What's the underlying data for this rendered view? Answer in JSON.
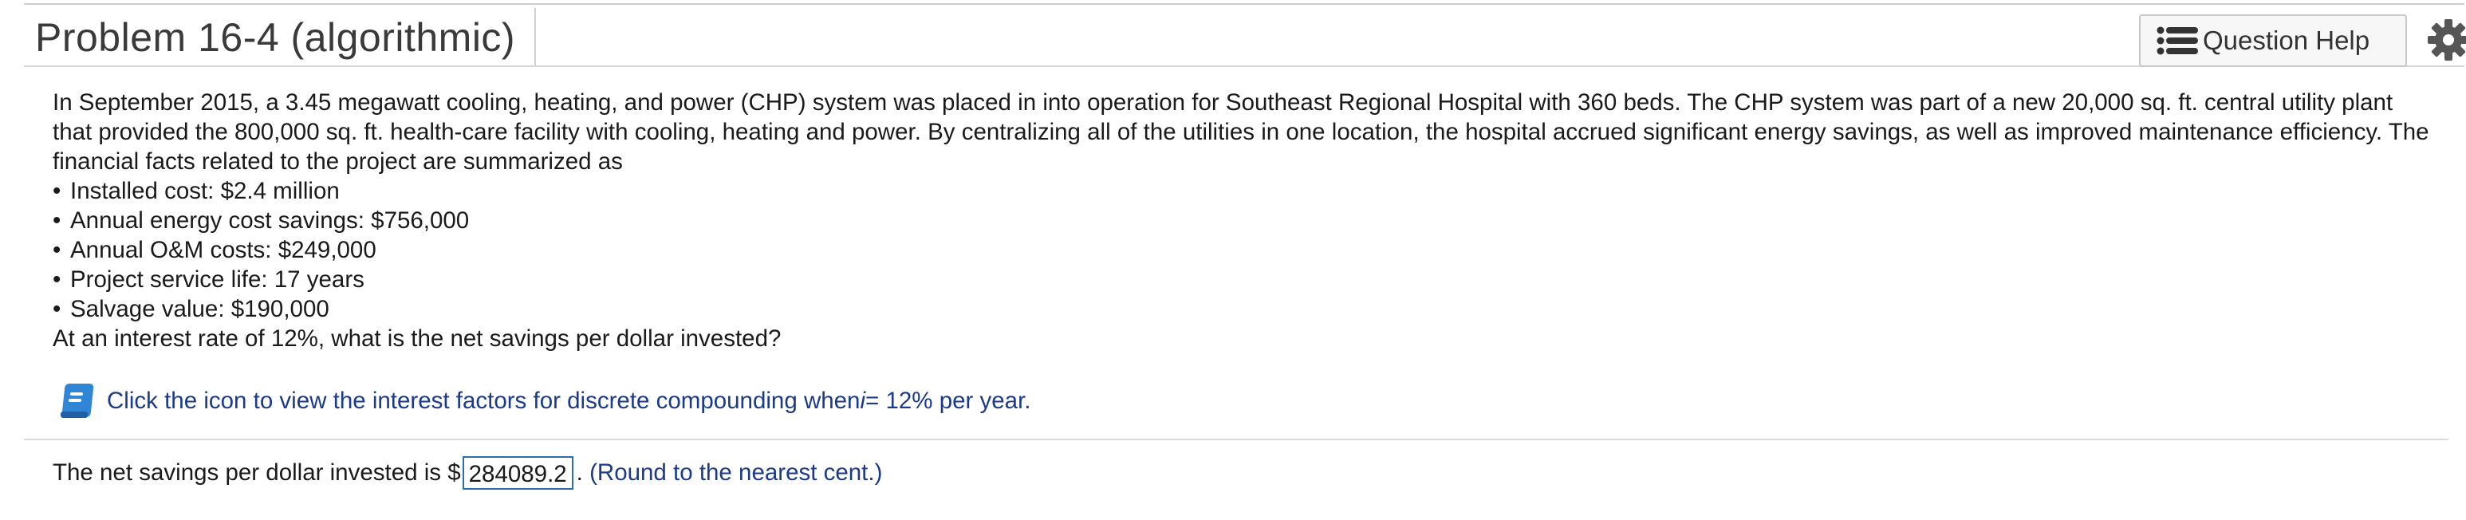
{
  "header": {
    "title": "Problem 16-4 (algorithmic)",
    "help_button_label": "Question Help",
    "help_icon": "list-icon",
    "settings_icon": "gear-icon"
  },
  "problem": {
    "intro": "In September 2015, a 3.45 megawatt cooling, heating, and power (CHP) system was placed in into operation for Southeast Regional Hospital with 360 beds. The CHP system was part of a new 20,000 sq. ft. central utility plant that provided the 800,000 sq. ft. health-care facility with cooling, heating and power. By centralizing all of the utilities in one location, the hospital accrued significant energy savings, as well as improved maintenance efficiency. The financial facts related to the project are summarized as",
    "bullets": [
      "Installed cost: $2.4 million",
      "Annual energy cost savings: $756,000",
      "Annual O&M costs: $249,000",
      "Project service life: 17 years",
      "Salvage value: $190,000"
    ],
    "question": "At an interest rate of 12%, what is the net savings per dollar invested?"
  },
  "factors_link": {
    "text_before": "Click the icon to view the interest factors for discrete compounding when ",
    "variable": "i",
    "text_after": " = 12% per year.",
    "icon": "book-icon"
  },
  "answer": {
    "prefix": "The net savings per dollar invested is $",
    "value": "284089.2",
    "suffix": ".",
    "hint": "(Round to the nearest cent.)"
  },
  "colors": {
    "link_blue": "#1b3a8a",
    "input_border": "#2e6ea8",
    "book_blue": "#2f86d6"
  }
}
